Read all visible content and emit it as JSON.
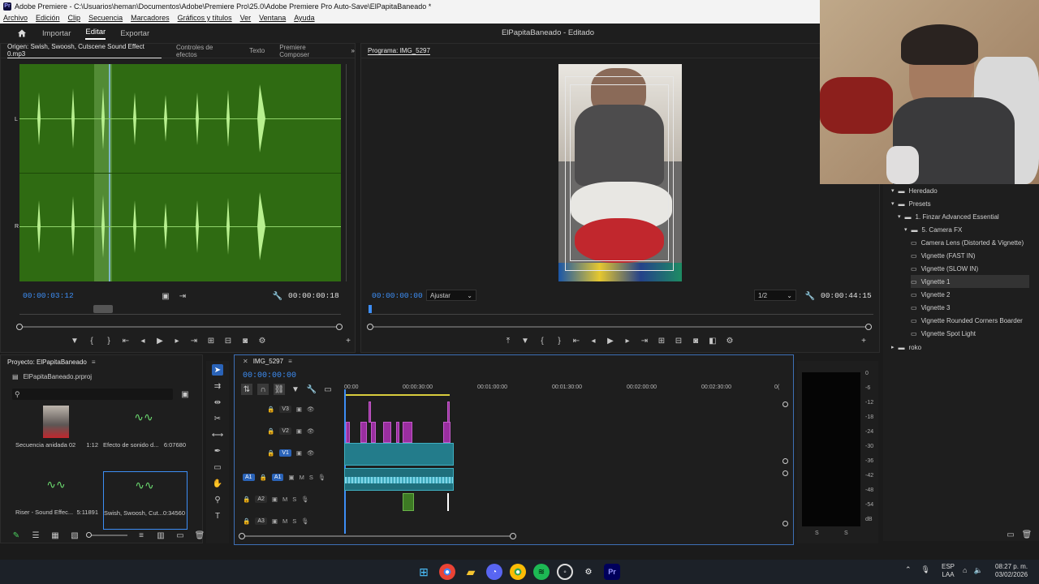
{
  "window": {
    "title": "Adobe Premiere - C:\\Usuarios\\heman\\Documentos\\Adobe\\Premiere Pro\\25.0\\Adobe Premiere Pro Auto-Save\\ElPapitaBaneado *",
    "app_icon": "Pr"
  },
  "menu": [
    "Archivo",
    "Edición",
    "Clip",
    "Secuencia",
    "Marcadores",
    "Gráficos y títulos",
    "Ver",
    "Ventana",
    "Ayuda"
  ],
  "nav": {
    "import": "Importar",
    "edit": "Editar",
    "export": "Exportar",
    "project_title": "ElPapitaBaneado - Editado"
  },
  "source": {
    "tabs": [
      "Origen: Swish, Swoosh, Cutscene Sound Effect 0.mp3",
      "Controles de efectos",
      "Texto",
      "Premiere Composer"
    ],
    "timecode_in": "00:00:03:12",
    "timecode_dur": "00:00:00:18",
    "channel_top": "L",
    "channel_bottom": "R",
    "waveform_color": "#2f6b12"
  },
  "program": {
    "tab": "Programa: IMG_5297",
    "timecode": "00:00:00:00",
    "fit": "Ajustar",
    "resolution": "1/2",
    "duration": "00:00:44:15"
  },
  "project": {
    "title": "Proyecto: ElPapitaBaneado",
    "file": "ElPapitaBaneado.prproj",
    "items": [
      {
        "name": "Secuencia anidada 02",
        "dur": "1:12"
      },
      {
        "name": "Efecto de sonido d...",
        "dur": "6:07680"
      },
      {
        "name": "Riser - Sound Effec...",
        "dur": "5:11891"
      },
      {
        "name": "Swish, Swoosh, Cut...",
        "dur": "0:34560"
      }
    ]
  },
  "timeline": {
    "tab": "IMG_5297",
    "timecode": "00:00:00:00",
    "ruler": [
      "00:00",
      "00:00:30:00",
      "00:01:00:00",
      "00:01:30:00",
      "00:02:00:00",
      "00:02:30:00",
      "0("
    ],
    "tracks": [
      "V3",
      "V2",
      "V1",
      "A1",
      "A2",
      "A3"
    ],
    "source_patch_v": "V1",
    "source_patch_a": "A1",
    "m": "M",
    "s": "S"
  },
  "meter": {
    "labels": [
      "0",
      "-6",
      "-12",
      "-18",
      "-24",
      "-30",
      "-36",
      "-42",
      "-48",
      "-54",
      "dB"
    ],
    "s_left": "S",
    "s_right": "S"
  },
  "effects": {
    "items": [
      {
        "label": "Heredado",
        "level": 0,
        "type": "folder"
      },
      {
        "label": "Presets",
        "level": 0,
        "type": "folder"
      },
      {
        "label": "1. Finzar Advanced Essential",
        "level": 1,
        "type": "folder"
      },
      {
        "label": "5. Camera FX",
        "level": 2,
        "type": "folder"
      },
      {
        "label": "Camera Lens (Distorted & Vignette)",
        "level": 3,
        "type": "preset"
      },
      {
        "label": "Vignette (FAST IN)",
        "level": 3,
        "type": "preset"
      },
      {
        "label": "Vignette (SLOW IN)",
        "level": 3,
        "type": "preset"
      },
      {
        "label": "Vignette 1",
        "level": 3,
        "type": "preset",
        "selected": true
      },
      {
        "label": "Vignette 2",
        "level": 3,
        "type": "preset"
      },
      {
        "label": "Vignette 3",
        "level": 3,
        "type": "preset"
      },
      {
        "label": "Vignette Rounded Corners Boarder",
        "level": 3,
        "type": "preset"
      },
      {
        "label": "Vignette Spot Light",
        "level": 3,
        "type": "preset"
      },
      {
        "label": "roko",
        "level": 0,
        "type": "folder"
      }
    ]
  },
  "taskbar": {
    "lang": "ESP",
    "region": "LAA",
    "time": "08:27 p. m.",
    "date": "03/02/2026"
  }
}
